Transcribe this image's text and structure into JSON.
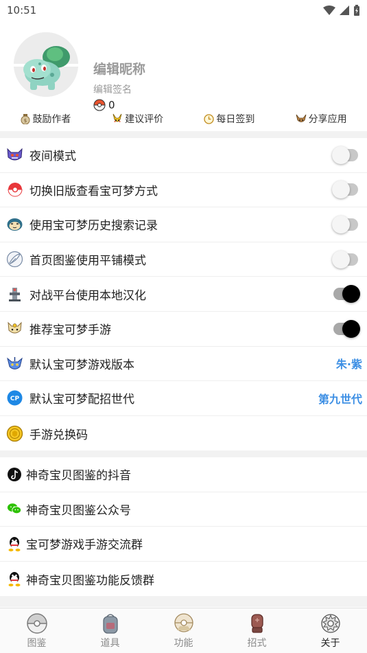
{
  "status_bar": {
    "time": "10:51"
  },
  "profile": {
    "nickname": "编辑昵称",
    "signature": "编辑签名",
    "coins": "0"
  },
  "actions": [
    {
      "label": "鼓励作者",
      "icon": "money-bag-icon"
    },
    {
      "label": "建议评价",
      "icon": "pikachu-icon"
    },
    {
      "label": "每日签到",
      "icon": "clock-icon"
    },
    {
      "label": "分享应用",
      "icon": "eevee-icon"
    }
  ],
  "settings": [
    {
      "label": "夜间模式",
      "icon": "gengar-icon",
      "toggle": false
    },
    {
      "label": "切换旧版查看宝可梦方式",
      "icon": "pokeball-icon",
      "toggle": false
    },
    {
      "label": "使用宝可梦历史搜索记录",
      "icon": "snorlax-icon",
      "toggle": false
    },
    {
      "label": "首页图鉴使用平铺模式",
      "icon": "feather-icon",
      "toggle": false
    },
    {
      "label": "对战平台使用本地汉化",
      "icon": "tower-icon",
      "toggle": true
    },
    {
      "label": "推荐宝可梦手游",
      "icon": "meowth-icon",
      "toggle": true
    },
    {
      "label": "默认宝可梦游戏版本",
      "icon": "miraidon-icon",
      "value": "朱·紫"
    },
    {
      "label": "默认宝可梦配招世代",
      "icon": "cp-icon",
      "value": "第九世代"
    },
    {
      "label": "手游兑换码",
      "icon": "coin-icon"
    }
  ],
  "social": [
    {
      "label": "神奇宝贝图鉴的抖音",
      "icon": "tiktok-icon"
    },
    {
      "label": "神奇宝贝图鉴公众号",
      "icon": "wechat-icon"
    },
    {
      "label": "宝可梦游戏手游交流群",
      "icon": "qq-icon"
    },
    {
      "label": "神奇宝贝图鉴功能反馈群",
      "icon": "qq-icon"
    }
  ],
  "bottom_nav": [
    {
      "label": "图鉴",
      "icon": "pokeball-nav-icon",
      "active": false
    },
    {
      "label": "道具",
      "icon": "backpack-nav-icon",
      "active": false
    },
    {
      "label": "功能",
      "icon": "dex-nav-icon",
      "active": false
    },
    {
      "label": "招式",
      "icon": "glove-nav-icon",
      "active": false
    },
    {
      "label": "关于",
      "icon": "settings-nav-icon",
      "active": true
    }
  ],
  "colors": {
    "accent_value": "#3d8fe4",
    "band": "#f2f2f2"
  }
}
